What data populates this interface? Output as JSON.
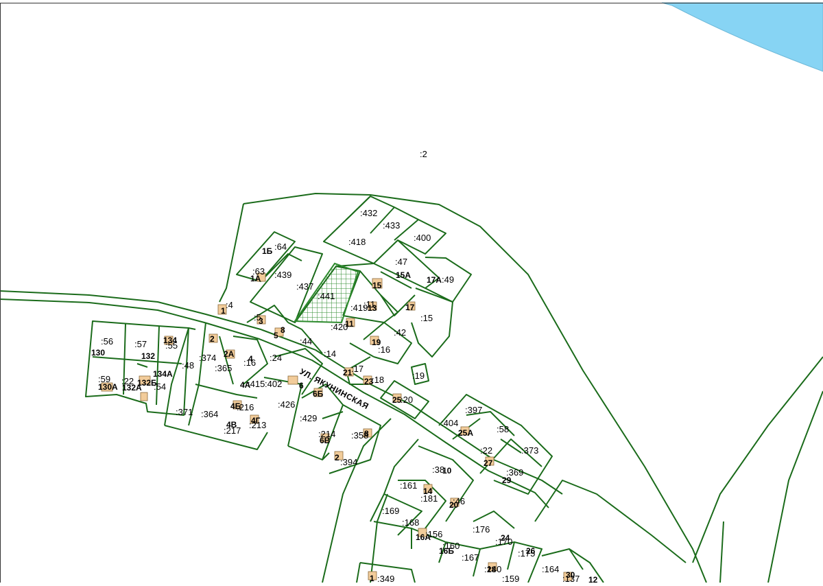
{
  "colors": {
    "parcel_line": "#1a6b1a",
    "water": "#87d4f4",
    "building": "#f2cc9a",
    "background": "#ffffff"
  },
  "street_name": "УЛ. ЯКУНИНСКАЯ",
  "cadastral_labels": [
    ":2",
    ":432",
    ":433",
    ":418",
    ":400",
    ":64",
    ":47",
    ":63",
    ":439",
    ":437",
    ":441",
    ":49",
    ":4",
    ":419",
    ":5",
    ":15",
    ":420",
    ":42",
    ":56",
    ":57",
    ":55",
    ":44",
    ":16",
    ":14",
    ":48",
    ":374",
    ":24",
    ":365",
    ":17",
    ":19",
    ":59",
    ":22",
    ":16",
    ":54",
    ":415",
    ":402",
    ":18",
    ":20",
    ":426",
    ":371",
    ":364",
    ":216",
    ":429",
    ":397",
    ":404",
    ":58",
    ":217",
    ":213",
    ":214",
    ":358",
    ":22",
    ":373",
    ":394",
    ":369",
    ":38",
    ":161",
    ":181",
    ":46",
    ":169",
    ":168",
    ":156",
    ":176",
    ":170",
    ":160",
    ":167",
    ":175",
    ":164",
    ":349",
    ":159",
    ":140",
    ":137",
    ":11"
  ],
  "house_numbers": [
    "1Б",
    "1А",
    "15",
    "15А",
    "17А",
    "17",
    "13",
    "11",
    "1",
    "3",
    "5",
    "8",
    "19",
    "2",
    "2А",
    "130",
    "132",
    "134",
    "134А",
    "130А",
    "132А",
    "132Б",
    "4",
    "4А",
    "4Б",
    "4В",
    "4Г",
    "6",
    "6Б",
    "6В",
    "21",
    "23",
    "25",
    "25А",
    "27",
    "29",
    "2",
    "8",
    "10",
    "12",
    "14",
    "20",
    "16А",
    "16Б",
    "24",
    "26",
    "28",
    "30",
    "1"
  ]
}
